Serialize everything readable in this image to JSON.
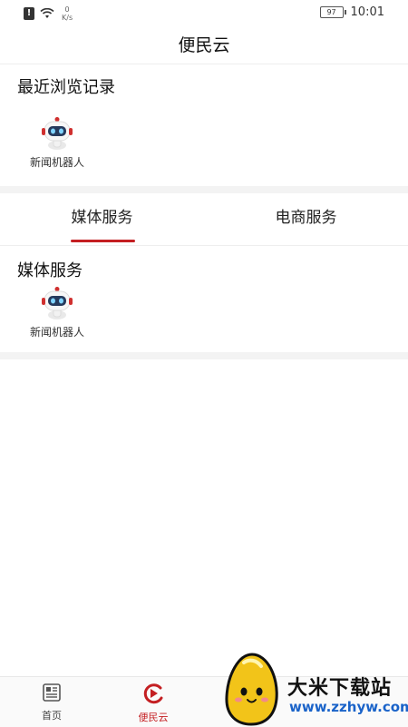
{
  "status_bar": {
    "net_speed_value": "0",
    "net_speed_unit": "K/s",
    "battery": "97",
    "time": "10:01"
  },
  "header": {
    "title": "便民云"
  },
  "recent": {
    "title": "最近浏览记录",
    "items": [
      {
        "label": "新闻机器人",
        "icon": "robot-icon"
      }
    ]
  },
  "tabs": [
    {
      "label": "媒体服务",
      "active": true
    },
    {
      "label": "电商服务",
      "active": false
    }
  ],
  "media_services": {
    "title": "媒体服务",
    "items": [
      {
        "label": "新闻机器人",
        "icon": "robot-icon"
      }
    ]
  },
  "bottom_nav": [
    {
      "label": "首页",
      "icon": "news-icon",
      "active": false
    },
    {
      "label": "便民云",
      "icon": "play-cloud-icon",
      "active": true
    }
  ],
  "watermark": {
    "brand": "大米下载站",
    "url": "www.zzhyw.com"
  },
  "colors": {
    "accent": "#c41f22",
    "watermark_url": "#1a63c9"
  }
}
